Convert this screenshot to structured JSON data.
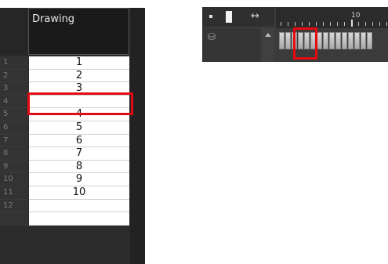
{
  "xsheet": {
    "column_name": "Drawing",
    "rows": [
      {
        "num": "1",
        "value": "1"
      },
      {
        "num": "2",
        "value": "2"
      },
      {
        "num": "3",
        "value": "3"
      },
      {
        "num": "4",
        "value": ""
      },
      {
        "num": "5",
        "value": "4"
      },
      {
        "num": "6",
        "value": "5"
      },
      {
        "num": "7",
        "value": "6"
      },
      {
        "num": "8",
        "value": "7"
      },
      {
        "num": "9",
        "value": "8"
      },
      {
        "num": "10",
        "value": "9"
      },
      {
        "num": "11",
        "value": "10"
      },
      {
        "num": "12",
        "value": ""
      },
      {
        "num": "",
        "value": ""
      }
    ],
    "highlight_color": "#e30b13"
  },
  "timeline": {
    "frame_label": "10",
    "frame_count": 15,
    "icons": [
      "dot-icon",
      "square-icon",
      "keyframe-icon",
      "layer-icon",
      "scroll-up-icon"
    ],
    "highlight_color": "#e30b13"
  }
}
